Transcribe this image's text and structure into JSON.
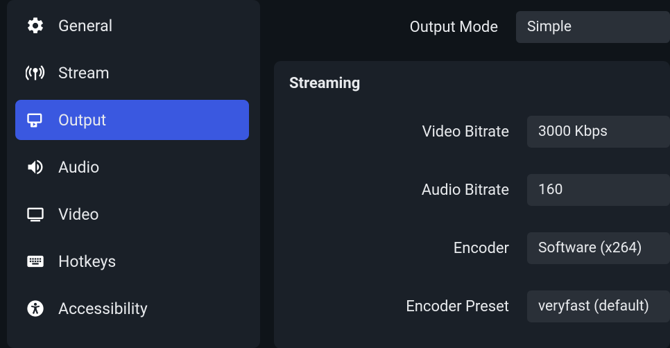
{
  "sidebar": {
    "items": [
      {
        "label": "General"
      },
      {
        "label": "Stream"
      },
      {
        "label": "Output"
      },
      {
        "label": "Audio"
      },
      {
        "label": "Video"
      },
      {
        "label": "Hotkeys"
      },
      {
        "label": "Accessibility"
      }
    ]
  },
  "top": {
    "output_mode_label": "Output Mode",
    "output_mode_value": "Simple"
  },
  "panel": {
    "title": "Streaming",
    "rows": [
      {
        "label": "Video Bitrate",
        "value": "3000 Kbps"
      },
      {
        "label": "Audio Bitrate",
        "value": "160"
      },
      {
        "label": "Encoder",
        "value": "Software (x264)"
      },
      {
        "label": "Encoder Preset",
        "value": "veryfast (default)"
      }
    ]
  }
}
